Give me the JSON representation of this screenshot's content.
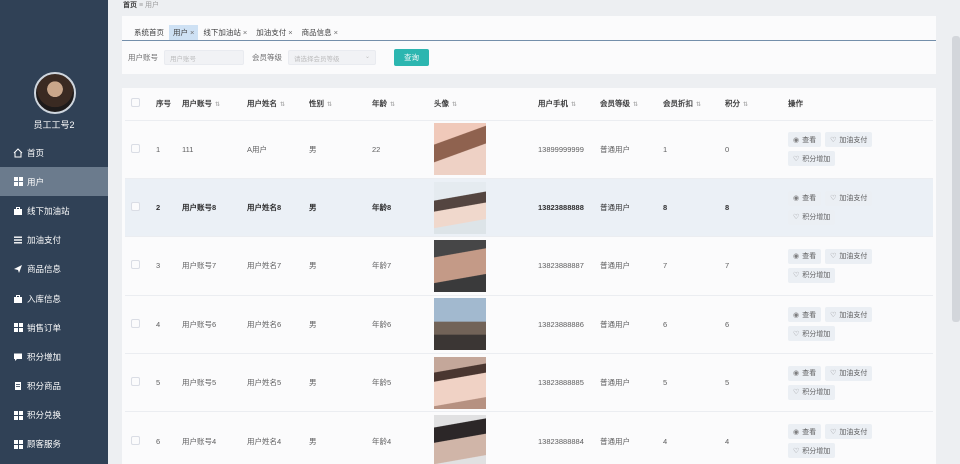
{
  "sidebar": {
    "username": "员工工号2",
    "items": [
      {
        "label": "首页",
        "icon": "home-icon"
      },
      {
        "label": "用户",
        "icon": "grid-icon",
        "active": true
      },
      {
        "label": "线下加油站",
        "icon": "briefcase-icon"
      },
      {
        "label": "加油支付",
        "icon": "list-icon"
      },
      {
        "label": "商品信息",
        "icon": "send-icon"
      },
      {
        "label": "入库信息",
        "icon": "briefcase-icon"
      },
      {
        "label": "销售订单",
        "icon": "grid-icon"
      },
      {
        "label": "积分增加",
        "icon": "comment-icon"
      },
      {
        "label": "积分商品",
        "icon": "document-icon"
      },
      {
        "label": "积分兑换",
        "icon": "grid-icon"
      },
      {
        "label": "顾客服务",
        "icon": "grid-icon"
      }
    ]
  },
  "breadcrumb": {
    "home": "首页",
    "sep": "≡",
    "current": "用户"
  },
  "tabs": [
    {
      "label": "系统首页",
      "closable": false
    },
    {
      "label": "用户",
      "closable": true,
      "active": true
    },
    {
      "label": "线下加油站",
      "closable": true
    },
    {
      "label": "加油支付",
      "closable": true
    },
    {
      "label": "商品信息",
      "closable": true
    }
  ],
  "filter": {
    "account_label": "用户账号",
    "account_placeholder": "用户账号",
    "level_label": "会员等级",
    "level_placeholder": "请选择会员等级",
    "query_button": "查询"
  },
  "table": {
    "headers": [
      "序号",
      "用户账号",
      "用户姓名",
      "性别",
      "年龄",
      "头像",
      "用户手机",
      "会员等级",
      "会员折扣",
      "积分",
      "操作"
    ],
    "rows": [
      {
        "no": "1",
        "account": "111",
        "name": "A用户",
        "gender": "男",
        "age": "22",
        "phone": "13899999999",
        "level": "普通用户",
        "discount": "1",
        "points": "0"
      },
      {
        "no": "2",
        "account": "用户账号8",
        "name": "用户姓名8",
        "gender": "男",
        "age": "年龄8",
        "phone": "13823888888",
        "level": "普通用户",
        "discount": "8",
        "points": "8"
      },
      {
        "no": "3",
        "account": "用户账号7",
        "name": "用户姓名7",
        "gender": "男",
        "age": "年龄7",
        "phone": "13823888887",
        "level": "普通用户",
        "discount": "7",
        "points": "7"
      },
      {
        "no": "4",
        "account": "用户账号6",
        "name": "用户姓名6",
        "gender": "男",
        "age": "年龄6",
        "phone": "13823888886",
        "level": "普通用户",
        "discount": "6",
        "points": "6"
      },
      {
        "no": "5",
        "account": "用户账号5",
        "name": "用户姓名5",
        "gender": "男",
        "age": "年龄5",
        "phone": "13823888885",
        "level": "普通用户",
        "discount": "5",
        "points": "5"
      },
      {
        "no": "6",
        "account": "用户账号4",
        "name": "用户姓名4",
        "gender": "男",
        "age": "年龄4",
        "phone": "13823888884",
        "level": "普通用户",
        "discount": "4",
        "points": "4"
      }
    ],
    "actions": {
      "view": "查看",
      "pay": "加油支付",
      "points": "积分增加"
    }
  },
  "colors": {
    "sidebar_bg": "#304156",
    "accent": "#1fb5ad",
    "active_tab": "#cfe3f7"
  }
}
